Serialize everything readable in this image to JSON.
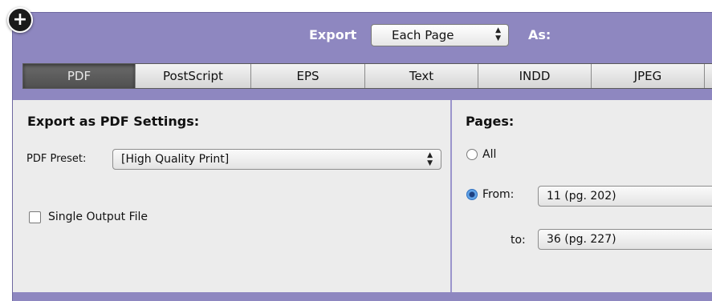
{
  "header": {
    "export_label": "Export",
    "export_scope": "Each Page",
    "as_label": "As:"
  },
  "tabs": [
    {
      "label": "PDF",
      "active": true
    },
    {
      "label": "PostScript",
      "active": false
    },
    {
      "label": "EPS",
      "active": false
    },
    {
      "label": "Text",
      "active": false
    },
    {
      "label": "INDD",
      "active": false
    },
    {
      "label": "JPEG",
      "active": false
    }
  ],
  "pdf_settings": {
    "title": "Export as PDF Settings:",
    "preset_label": "PDF Preset:",
    "preset_value": "[High Quality Print]",
    "single_output_label": "Single Output File",
    "single_output_checked": false
  },
  "pages": {
    "title": "Pages:",
    "all_label": "All",
    "from_label": "From:",
    "from_value": "11 (pg. 202)",
    "to_label": "to:",
    "to_value": "36 (pg. 227)",
    "selected": "from"
  },
  "colors": {
    "header_bg": "#8e87c0",
    "content_bg": "#ececec"
  }
}
